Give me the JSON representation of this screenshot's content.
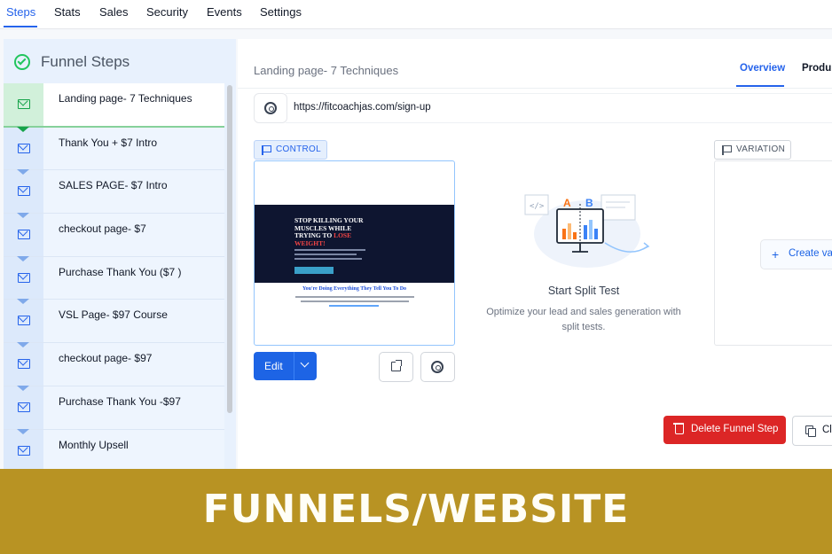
{
  "top_nav": {
    "tabs": [
      "Steps",
      "Stats",
      "Sales",
      "Security",
      "Events",
      "Settings"
    ],
    "active": "Steps"
  },
  "sidebar": {
    "title": "Funnel Steps",
    "steps": [
      {
        "label": "Landing page- 7 Techniques",
        "active": true
      },
      {
        "label": "Thank You + $7 Intro"
      },
      {
        "label": "SALES PAGE- $7 Intro"
      },
      {
        "label": "checkout page- $7"
      },
      {
        "label": "Purchase Thank You ($7 )"
      },
      {
        "label": "VSL Page- $97 Course"
      },
      {
        "label": "checkout page- $97"
      },
      {
        "label": "Purchase Thank You -$97"
      },
      {
        "label": "Monthly Upsell"
      }
    ]
  },
  "main": {
    "page_title": "Landing page- 7 Techniques",
    "tabs": [
      "Overview",
      "Produ"
    ],
    "active_tab": "Overview",
    "url": "https://fitcoachjas.com/sign-up",
    "control": {
      "badge": "CONTROL",
      "preview": {
        "headline_1": "STOP KILLING YOUR",
        "headline_2": "MUSCLES WHILE",
        "headline_3": "TRYING TO",
        "headline_red": "LOSE",
        "headline_4": "WEIGHT!",
        "subhead": "You're Doing Everything They Tell You To Do"
      },
      "edit_label": "Edit"
    },
    "split_test": {
      "title": "Start Split Test",
      "description": "Optimize your lead and sales generation with split tests.",
      "label_a": "A",
      "label_b": "B"
    },
    "variation": {
      "badge": "VARIATION",
      "create_label": "Create var"
    },
    "delete_label": "Delete Funnel Step",
    "clone_label": "Cl"
  },
  "banner": {
    "text": "FUNNELS/WEBSITE"
  },
  "colors": {
    "accent": "#2563eb",
    "danger": "#dc2626",
    "banner": "#b89323",
    "success": "#22c55e"
  }
}
